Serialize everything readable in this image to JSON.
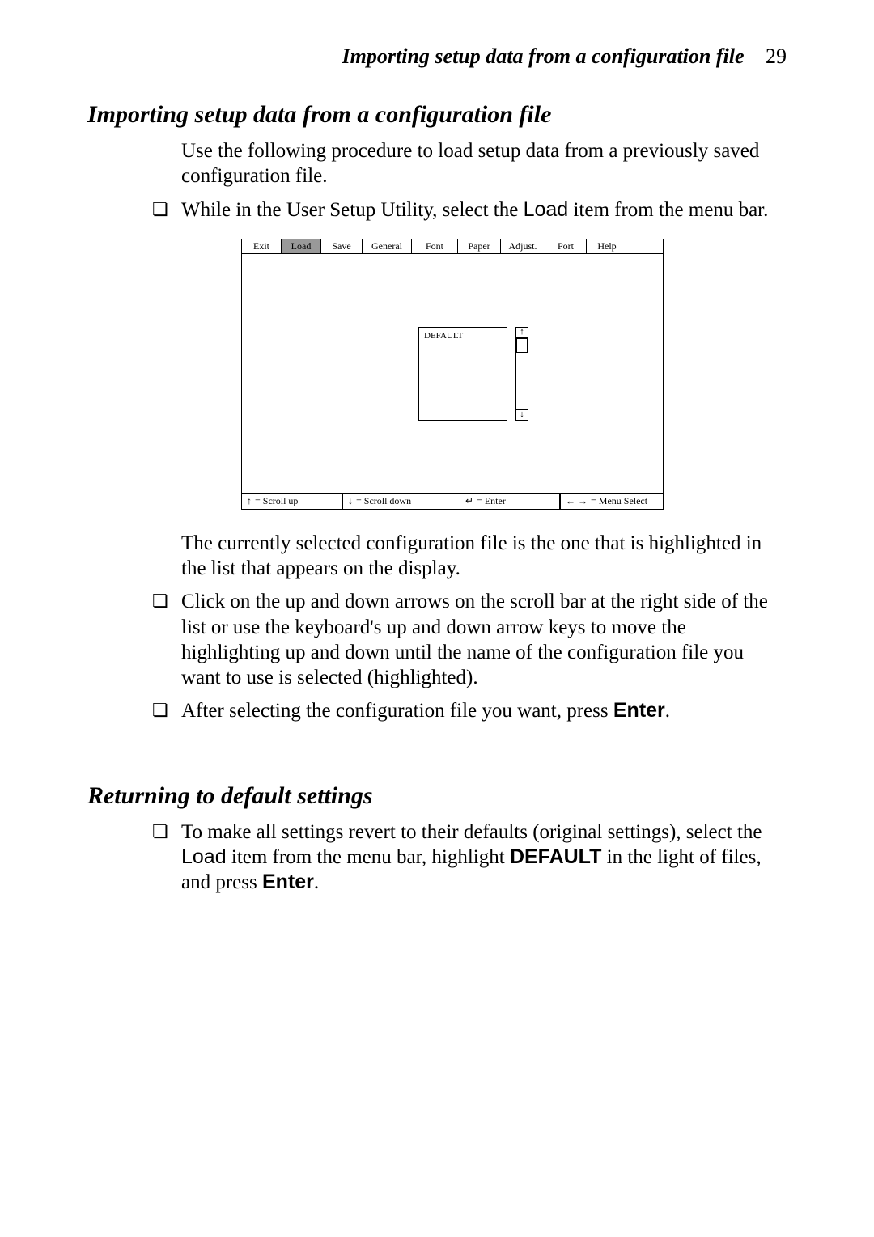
{
  "header": {
    "running_title": "Importing setup data from a configuration file",
    "page_number": "29"
  },
  "section1": {
    "title": "Importing setup data from a configuration file",
    "intro": "Use the following procedure to load setup data from a previously saved configuration file.",
    "step1_pre": "While in the User Setup Utility, select the ",
    "step1_load": "Load",
    "step1_post": " item from the menu bar.",
    "after_fig": "The currently selected configuration file is the one that is highlighted in the list that appears on the display.",
    "step2": "Click on the up and down arrows on the scroll bar at the right side of the list or use the keyboard's up and down arrow keys to move the highlighting up and down until the name of the configuration file you want to use is selected (highlighted).",
    "step3_pre": "After selecting the configuration file you want, press ",
    "step3_enter": "Enter",
    "step3_post": "."
  },
  "figure": {
    "menu": {
      "exit": "Exit",
      "load": "Load",
      "save": "Save",
      "general": "General",
      "font": "Font",
      "paper": "Paper",
      "adjust": "Adjust.",
      "port": "Port",
      "help": "Help"
    },
    "listbox": {
      "default": "DEFAULT"
    },
    "scroll": {
      "up": "↑",
      "down": "↓"
    },
    "status": {
      "scroll_up": " = Scroll up",
      "scroll_down": " = Scroll down",
      "enter": " = Enter",
      "menu_select": " = Menu Select",
      "arrow_up": "↑",
      "arrow_down": "↓",
      "enter_glyph": "↵",
      "lr_glyph": "← →"
    }
  },
  "section2": {
    "title": "Returning to default settings",
    "step1_a": "To make all settings revert to their defaults (original settings), select the ",
    "step1_load": "Load",
    "step1_b": " item from the menu bar, highlight ",
    "step1_default": "DEFAULT",
    "step1_c": " in the light of files, and press ",
    "step1_enter": "Enter",
    "step1_d": "."
  }
}
